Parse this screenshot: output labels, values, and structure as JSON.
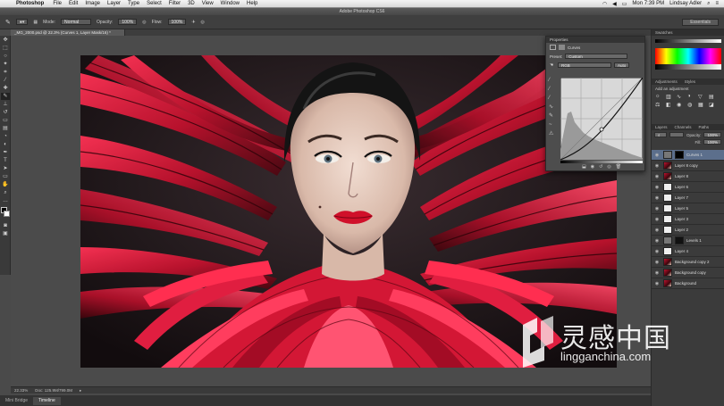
{
  "menubar": {
    "app": "Photoshop",
    "items": [
      "File",
      "Edit",
      "Image",
      "Layer",
      "Type",
      "Select",
      "Filter",
      "3D",
      "View",
      "Window",
      "Help"
    ],
    "clock": "Mon 7:39 PM",
    "user": "Lindsay Adler"
  },
  "window": {
    "title": "Adobe Photoshop CS6"
  },
  "options": {
    "mode_label": "Mode:",
    "mode_value": "Normal",
    "opacity_label": "Opacity:",
    "opacity_value": "100%",
    "flow_label": "Flow:",
    "flow_value": "100%",
    "workspace": "Essentials"
  },
  "document": {
    "tab": "_MG_2000.psd @ 22.3% (Curves 1, Layer Mask/16) *",
    "zoom": "22.33%",
    "doc_size": "Doc: 125.9M/799.0M"
  },
  "bottom_tabs": [
    "Mini Bridge",
    "Timeline"
  ],
  "properties": {
    "panel_title": "Properties",
    "adjustment": "Curves",
    "preset_label": "Preset:",
    "preset_value": "Custom",
    "channel_value": "RGB",
    "auto_label": "Auto"
  },
  "dock": {
    "swatches_tabs": [
      "Swatches"
    ],
    "adjust_tabs": [
      "Adjustments",
      "Styles"
    ],
    "adjust_hint": "Add an adjustment",
    "layers_tabs": [
      "Layers",
      "Channels",
      "Paths"
    ],
    "opacity_label": "Opacity:",
    "opacity_value": "100%",
    "fill_label": "Fill:",
    "fill_value": "100%",
    "layers": [
      {
        "name": "Curves 1",
        "selected": true,
        "type": "adjust"
      },
      {
        "name": "Layer 8 copy",
        "selected": false,
        "type": "photo"
      },
      {
        "name": "Layer 8",
        "selected": false,
        "type": "photo"
      },
      {
        "name": "Layer 6",
        "selected": false,
        "type": "blank"
      },
      {
        "name": "Layer 7",
        "selected": false,
        "type": "blank"
      },
      {
        "name": "Layer 5",
        "selected": false,
        "type": "blank"
      },
      {
        "name": "Layer 3",
        "selected": false,
        "type": "blank"
      },
      {
        "name": "Layer 2",
        "selected": false,
        "type": "blank"
      },
      {
        "name": "Levels 1",
        "selected": false,
        "type": "adjust"
      },
      {
        "name": "Layer 4",
        "selected": false,
        "type": "blank"
      },
      {
        "name": "Background copy 2",
        "selected": false,
        "type": "photo"
      },
      {
        "name": "Background copy",
        "selected": false,
        "type": "photo"
      },
      {
        "name": "Background",
        "selected": false,
        "type": "photo"
      }
    ]
  },
  "watermark": {
    "text_cn": "灵感中国",
    "url": "lingganchina.com"
  },
  "colors": {
    "accent_red": "#d8183a",
    "panel_bg": "#3b3b3b",
    "selected_layer": "#5c6f8c"
  }
}
